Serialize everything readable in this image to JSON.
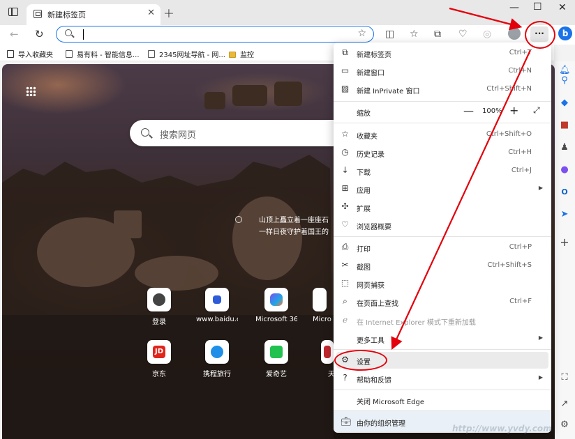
{
  "tab": {
    "title": "新建标签页"
  },
  "address_bar": {
    "value": ""
  },
  "window_controls": {
    "minimize": "—",
    "maximize": "☐",
    "close": "✕"
  },
  "favorites": [
    {
      "label": "导入收藏夹",
      "kind": "import"
    },
    {
      "label": "易有料 - 智能信息...",
      "kind": "page"
    },
    {
      "label": "2345网址导航 - 网...",
      "kind": "page"
    },
    {
      "label": "监控",
      "kind": "folder"
    }
  ],
  "new_tab_page": {
    "search_placeholder": "搜索网页",
    "photo_caption": [
      "山顶上矗立着一座座石",
      "一样日夜守护着国王的"
    ],
    "quick_links": [
      {
        "label": "登录",
        "icon": "camera-icon"
      },
      {
        "label": "www.baidu.c...",
        "icon": "baidu-icon"
      },
      {
        "label": "Microsoft 365",
        "icon": "m365-icon"
      },
      {
        "label": "Micro",
        "icon": "app-icon"
      },
      {
        "label": "京东",
        "icon": "jd-icon"
      },
      {
        "label": "携程旅行",
        "icon": "ctrip-icon"
      },
      {
        "label": "爱奇艺",
        "icon": "iqiyi-icon"
      },
      {
        "label": "天",
        "icon": "app-icon"
      }
    ]
  },
  "menu": {
    "new_tab": {
      "label": "新建标签页",
      "shortcut": "Ctrl+T"
    },
    "new_window": {
      "label": "新建窗口",
      "shortcut": "Ctrl+N"
    },
    "new_inprivate": {
      "label": "新建 InPrivate 窗口",
      "shortcut": "Ctrl+Shift+N"
    },
    "zoom": {
      "label": "缩放",
      "value": "100%",
      "minus": "—",
      "plus": "+"
    },
    "favorites": {
      "label": "收藏夹",
      "shortcut": "Ctrl+Shift+O"
    },
    "history": {
      "label": "历史记录",
      "shortcut": "Ctrl+H"
    },
    "downloads": {
      "label": "下载",
      "shortcut": "Ctrl+J"
    },
    "apps": {
      "label": "应用"
    },
    "extensions": {
      "label": "扩展"
    },
    "essentials": {
      "label": "浏览器概要"
    },
    "print": {
      "label": "打印",
      "shortcut": "Ctrl+P"
    },
    "screenshot": {
      "label": "截图",
      "shortcut": "Ctrl+Shift+S"
    },
    "web_capture": {
      "label": "网页捕获"
    },
    "find": {
      "label": "在页面上查找",
      "shortcut": "Ctrl+F"
    },
    "ie_mode": {
      "label": "在 Internet Explorer 模式下重新加载"
    },
    "more_tools": {
      "label": "更多工具"
    },
    "settings": {
      "label": "设置"
    },
    "help": {
      "label": "帮助和反馈"
    },
    "close_edge": {
      "label": "关闭 Microsoft Edge"
    },
    "managed": {
      "label": "由你的组织管理"
    }
  },
  "watermark": "http://www.yvdy.com",
  "colors": {
    "accent": "#1a73e8",
    "annotation": "#e3000b"
  }
}
